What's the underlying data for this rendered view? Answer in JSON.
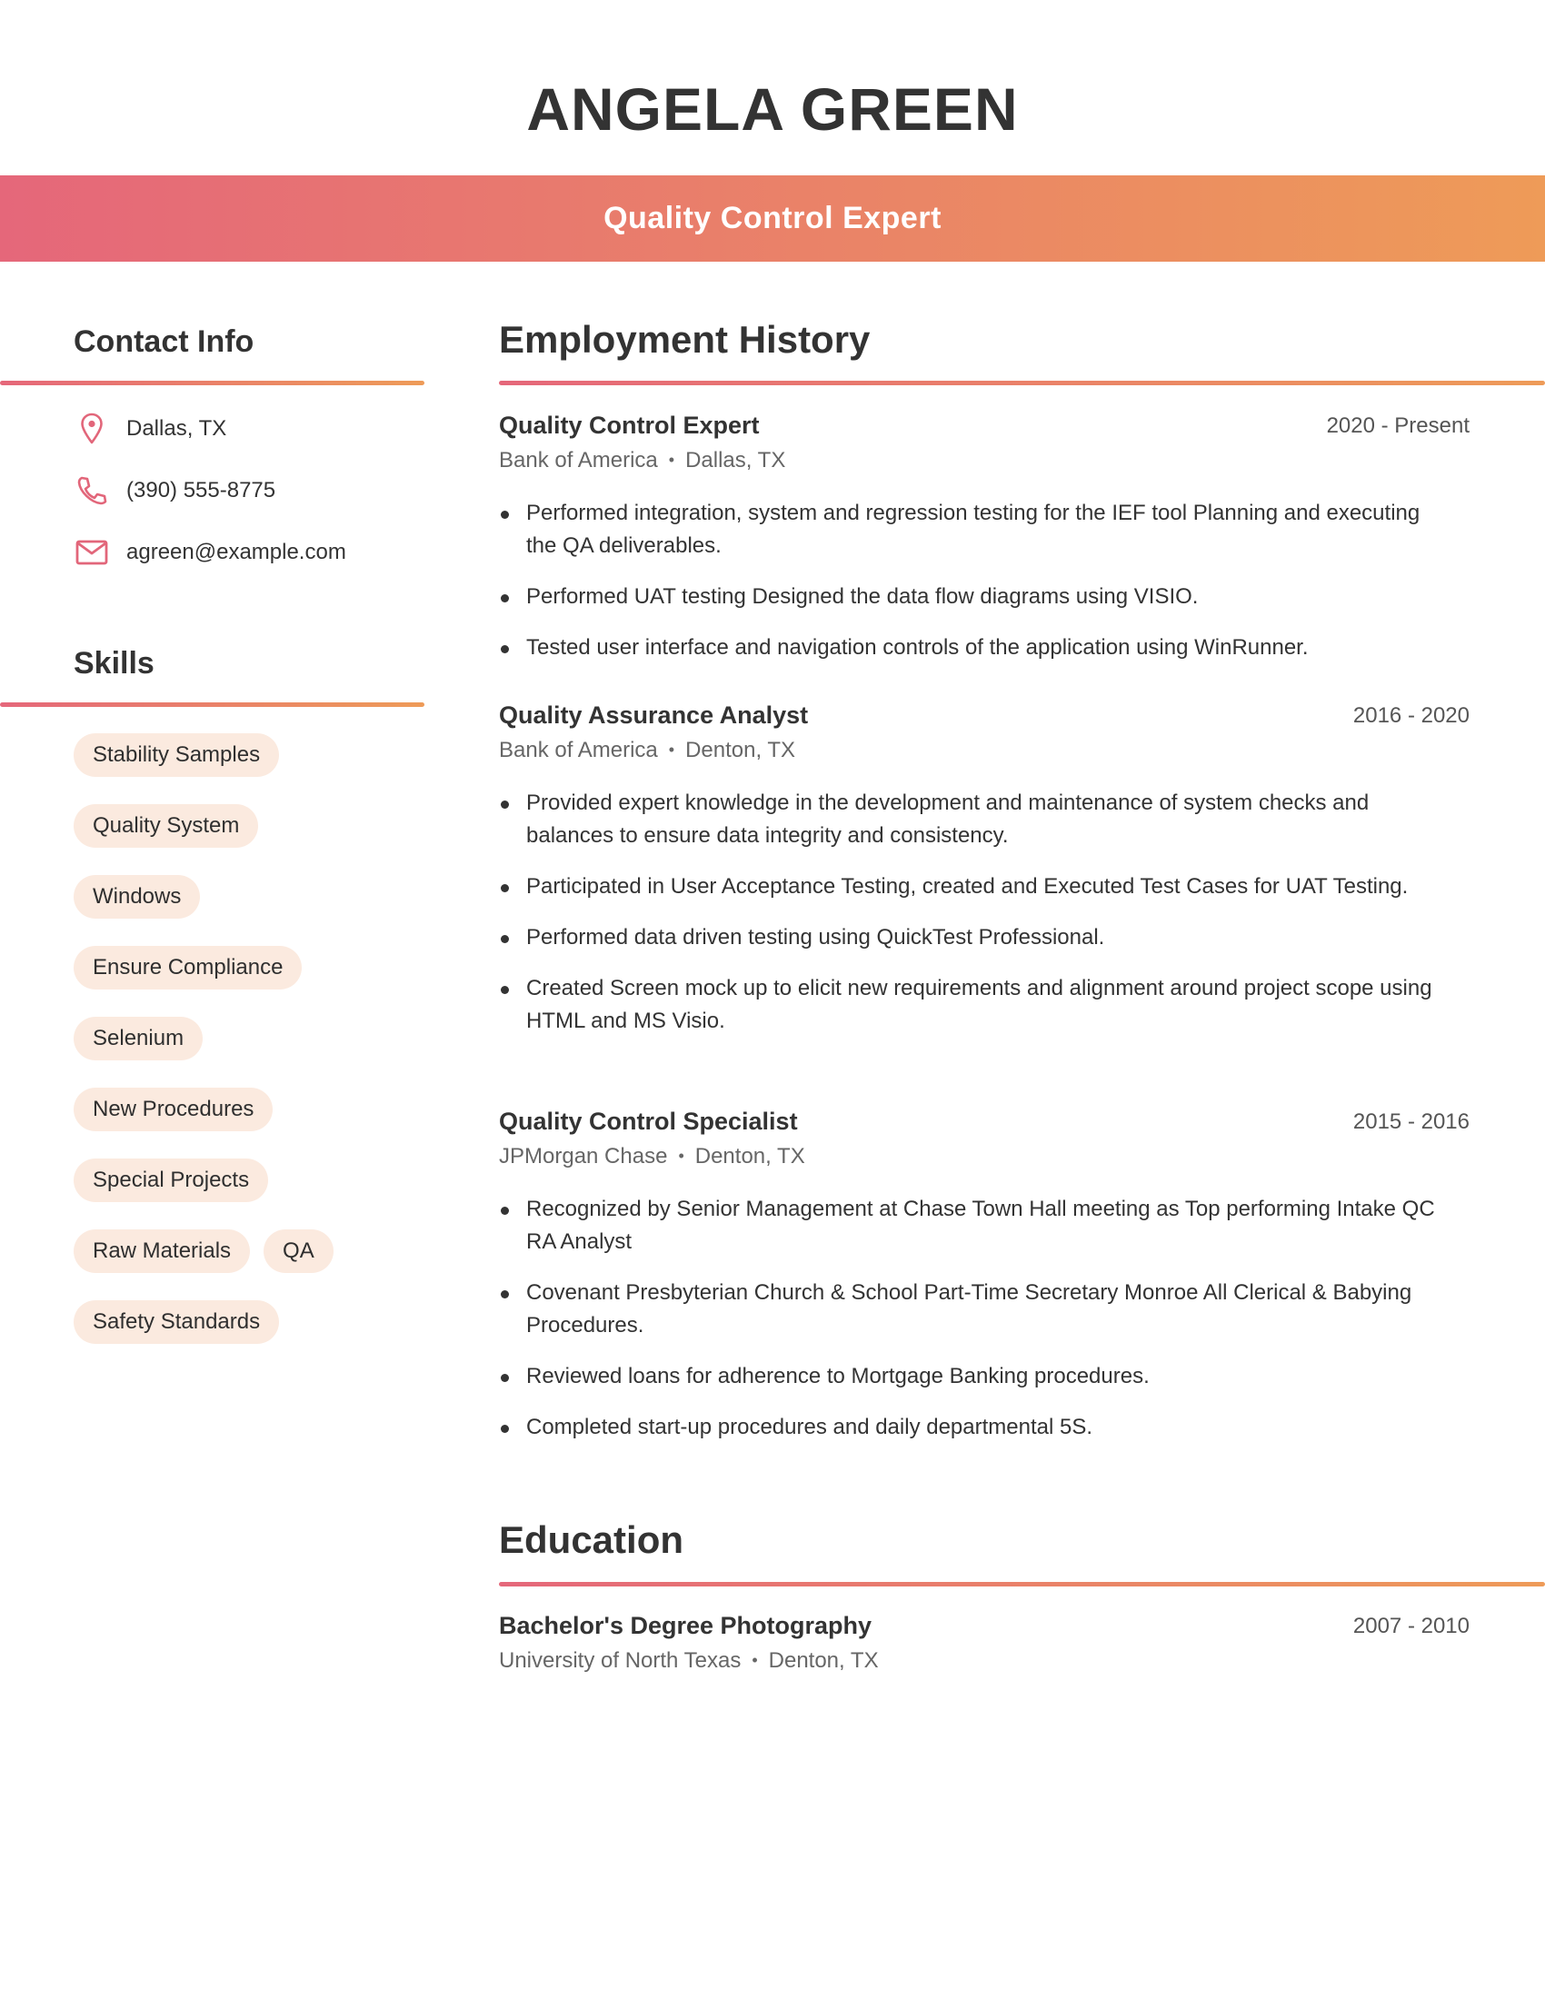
{
  "header": {
    "name": "ANGELA GREEN",
    "job_title": "Quality Control Expert"
  },
  "colors": {
    "gradient_start": "#E5677A",
    "gradient_end": "#EE9B58",
    "chip_background": "#FBEADF",
    "icon": "#E2667A"
  },
  "contact": {
    "title": "Contact Info",
    "items": [
      {
        "icon": "location-pin-icon",
        "text": "Dallas, TX"
      },
      {
        "icon": "phone-icon",
        "text": "(390) 555-8775"
      },
      {
        "icon": "email-icon",
        "text": "agreen@example.com"
      }
    ]
  },
  "skills": {
    "title": "Skills",
    "items": [
      "Stability Samples",
      "Quality System",
      "Windows",
      "Ensure Compliance",
      "Selenium",
      "New Procedures",
      "Special Projects",
      "Raw Materials",
      "QA",
      "Safety Standards"
    ]
  },
  "employment": {
    "title": "Employment History",
    "jobs": [
      {
        "title": "Quality Control Expert",
        "dates": "2020 - Present",
        "company": "Bank of America",
        "location": "Dallas, TX",
        "bullets": [
          "Performed integration, system and regression testing for the IEF tool Planning and executing the QA deliverables.",
          "Performed UAT testing Designed the data flow diagrams using VISIO.",
          "Tested user interface and navigation controls of the application using WinRunner."
        ]
      },
      {
        "title": "Quality Assurance Analyst",
        "dates": "2016 - 2020",
        "company": "Bank of America",
        "location": "Denton, TX",
        "bullets": [
          "Provided expert knowledge in the development and maintenance of system checks and balances to ensure data integrity and consistency.",
          "Participated in User Acceptance Testing, created and Executed Test Cases for UAT Testing.",
          "Performed data driven testing using QuickTest Professional.",
          "Created Screen mock up to elicit new requirements and alignment around project scope using HTML and MS Visio."
        ]
      },
      {
        "title": "Quality Control Specialist",
        "dates": "2015 - 2016",
        "company": "JPMorgan Chase",
        "location": "Denton, TX",
        "bullets": [
          "Recognized by Senior Management at Chase Town Hall meeting as Top performing Intake QC RA Analyst",
          "Covenant Presbyterian Church & School Part-Time Secretary Monroe All Clerical & Babying Procedures.",
          "Reviewed loans for adherence to Mortgage Banking procedures.",
          "Completed start-up procedures and daily departmental 5S."
        ]
      }
    ]
  },
  "education": {
    "title": "Education",
    "items": [
      {
        "degree": "Bachelor's Degree Photography",
        "dates": "2007 - 2010",
        "school": "University of North Texas",
        "location": "Denton, TX"
      }
    ]
  },
  "separator": "•"
}
